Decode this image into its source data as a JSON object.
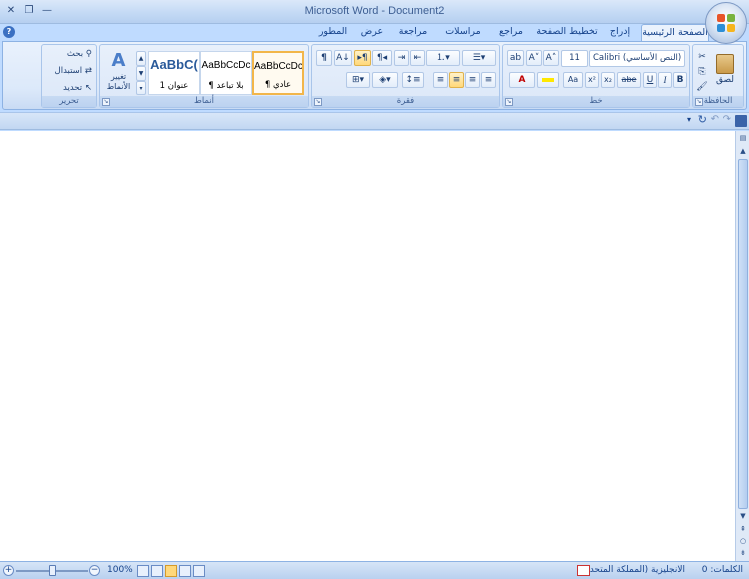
{
  "window": {
    "title": "Microsoft Word - Document2",
    "controls": [
      "close-icon",
      "restore-icon",
      "minimize-icon"
    ]
  },
  "tabs": [
    {
      "label": "الصفحة الرئيسية",
      "active": true
    },
    {
      "label": "إدراج"
    },
    {
      "label": "تخطيط الصفحة"
    },
    {
      "label": "مراجع"
    },
    {
      "label": "مراسلات"
    },
    {
      "label": "مراجعة"
    },
    {
      "label": "عرض"
    },
    {
      "label": "المطور"
    }
  ],
  "clipboard": {
    "label": "الحافظة",
    "paste": "لصق"
  },
  "font": {
    "label": "خط",
    "font_name": "Calibri (النص الأساسي)",
    "font_size": "11"
  },
  "paragraph": {
    "label": "فقرة"
  },
  "styles": {
    "label": "أنماط",
    "items": [
      {
        "sample": "AaBbCcDc",
        "name": "¶ عادي",
        "selected": true
      },
      {
        "sample": "AaBbCcDc",
        "name": "¶ بلا تباعد"
      },
      {
        "sample": "AaBbC(",
        "name": "عنوان 1"
      }
    ],
    "change_styles": "تغيير الأنماط"
  },
  "editing": {
    "label": "تحرير",
    "find": "بحث",
    "replace": "استبدال",
    "select": "تحديد"
  },
  "statusbar": {
    "words": "الكلمات: 0",
    "language": "الانجليزية (المملكة المتحدة)",
    "zoom": "100%"
  },
  "colors": {
    "accent": "#15428b",
    "ribbon": "#dbe7f8",
    "highlight": "#ffd87a"
  }
}
